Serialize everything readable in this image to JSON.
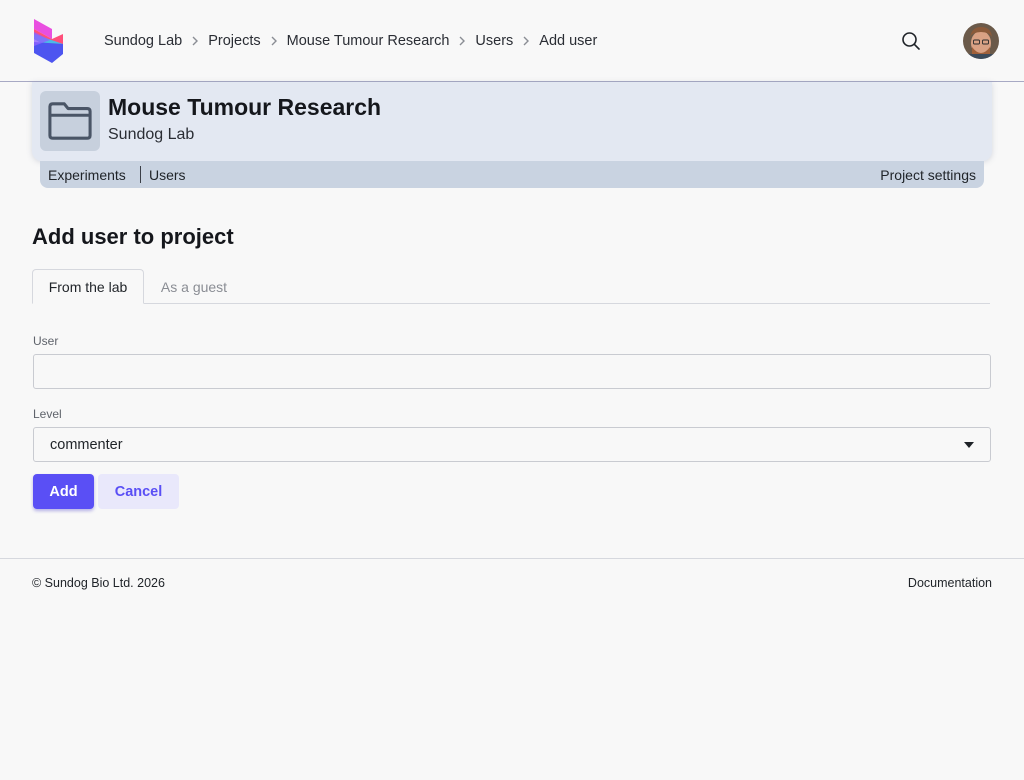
{
  "header": {
    "breadcrumb": [
      "Sundog Lab",
      "Projects",
      "Mouse Tumour Research",
      "Users",
      "Add user"
    ],
    "icons": {
      "logo": "sundog-logo-icon",
      "search": "search-icon",
      "avatar": "user-avatar",
      "separator": "chevron-right-icon"
    }
  },
  "project": {
    "title": "Mouse Tumour Research",
    "lab": "Sundog Lab",
    "icon": "folder-icon",
    "nav": {
      "experiments": "Experiments",
      "users": "Users",
      "settings": "Project settings"
    }
  },
  "form": {
    "heading": "Add user to project",
    "tabs": [
      {
        "label": "From the lab",
        "active": true
      },
      {
        "label": "As a guest",
        "active": false
      }
    ],
    "user_label": "User",
    "user_value": "",
    "level_label": "Level",
    "level_value": "commenter",
    "add_label": "Add",
    "cancel_label": "Cancel"
  },
  "footer": {
    "copyright": "© Sundog Bio Ltd. 2026",
    "docs": "Documentation"
  },
  "colors": {
    "accent": "#5a4ff5",
    "project_card": "#e3e8f2",
    "project_nav": "#c9d3e1"
  }
}
